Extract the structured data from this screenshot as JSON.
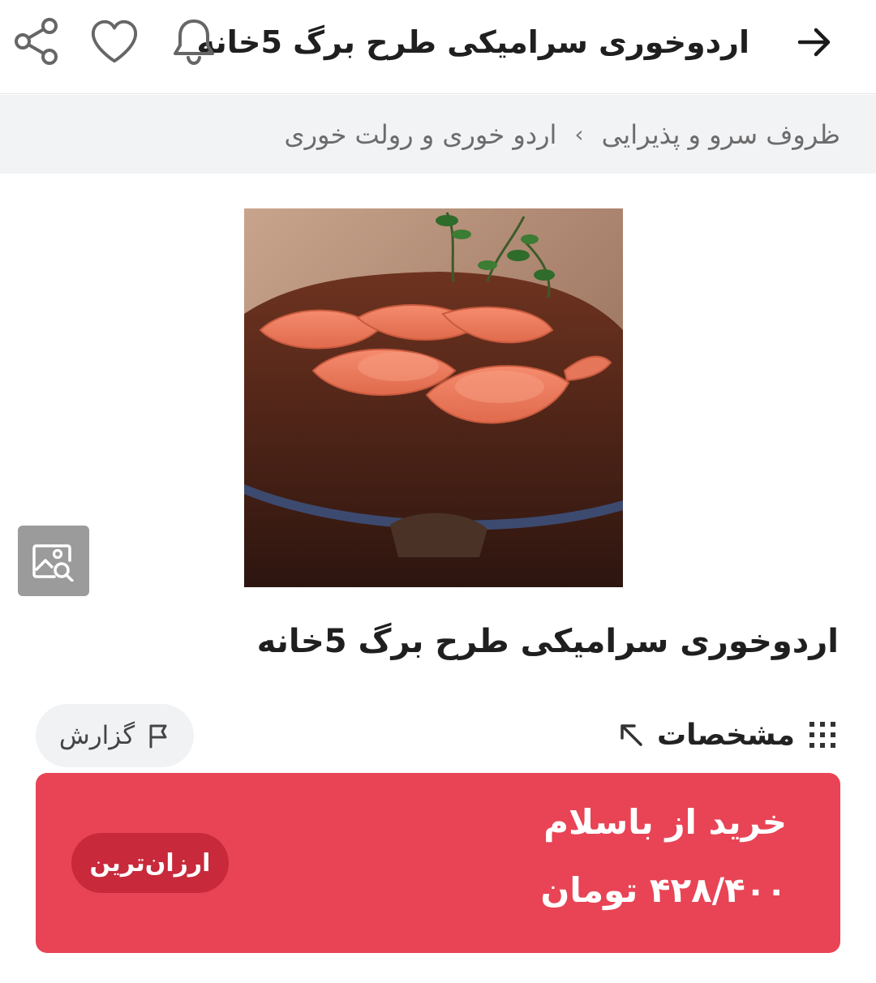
{
  "header": {
    "title": "اردوخوری سرامیکی طرح برگ 5خانه",
    "back_icon": "arrow-right-icon",
    "bell_icon": "bell-icon",
    "heart_icon": "heart-icon",
    "share_icon": "share-icon"
  },
  "breadcrumb": {
    "items": [
      "ظروف سرو و پذیرایی",
      "اردو خوری و رولت خوری"
    ],
    "separator": "›"
  },
  "product": {
    "title": "اردوخوری سرامیکی طرح برگ 5خانه",
    "image_icon": "image-search-icon"
  },
  "actions": {
    "specs_label": "مشخصات",
    "specs_icon": "grid-dots-icon",
    "specs_arrow_icon": "arrow-up-left-icon",
    "report_label": "گزارش",
    "report_icon": "flag-icon"
  },
  "buy": {
    "label": "خرید از باسلام",
    "price": "۴۲۸/۴۰۰ تومان",
    "badge": "ارزان‌ترین",
    "color": "#e84455"
  }
}
